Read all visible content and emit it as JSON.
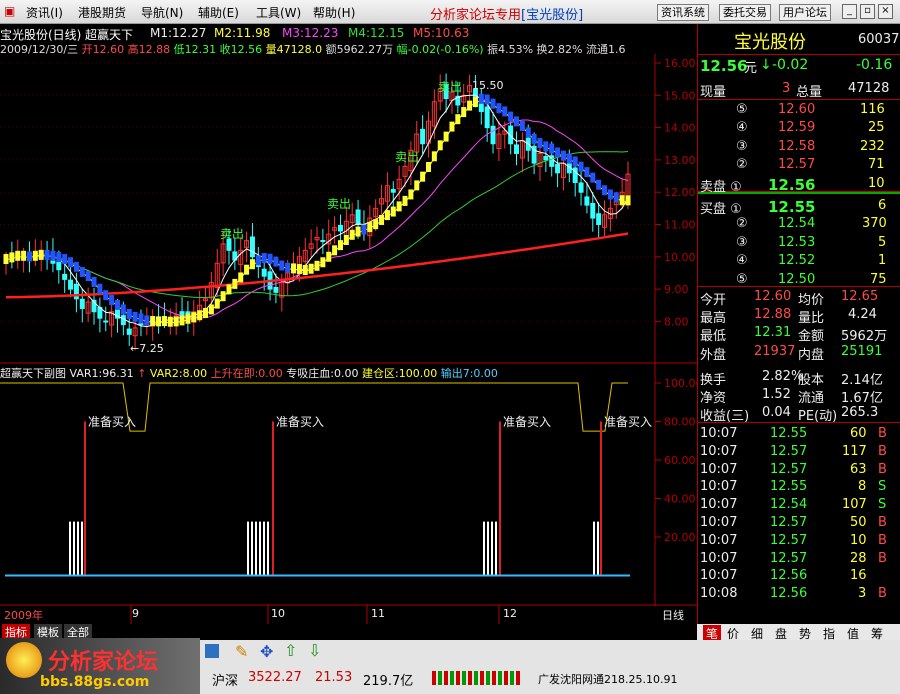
{
  "menu": {
    "items": [
      "资讯(I)",
      "港股期货",
      "导航(N)",
      "辅助(E)",
      "工具(W)",
      "帮助(H)"
    ],
    "title": "分析家论坛专用",
    "title_stock": "[宝光股份]",
    "buttons": [
      "资讯系统",
      "委托交易",
      "用户论坛"
    ]
  },
  "chart_header": {
    "stock": "宝光股份(日线)",
    "indicator": "超赢天下",
    "m1": "M1:12.27",
    "m2": "M2:11.98",
    "m3": "M3:12.23",
    "m4": "M4:12.15",
    "m5": "M5:10.63"
  },
  "info": {
    "date": "2009/12/30/三",
    "open": "开12.60",
    "high": "高12.88",
    "low": "低12.31",
    "close": "收12.56",
    "vol": "量47128.0",
    "amt": "额5962.27万",
    "fluct": "幅-0.02(-0.16%)",
    "amp": "振4.53%",
    "turn": "换2.82%",
    "float": "流通1.6"
  },
  "price_axis": [
    "16.00",
    "15.00",
    "14.00",
    "13.00",
    "12.00",
    "11.00",
    "10.00",
    "9.00",
    "8.00"
  ],
  "chart_labels": {
    "sell": "卖出",
    "buy": "买入",
    "high": "15.50",
    "low": "←7.25"
  },
  "sub_header": {
    "name": "超赢天下副图",
    "var1": "VAR1:96.31",
    "var2": "VAR2:8.00",
    "up": "上升在即:0.00",
    "zh": "专吸庄血:0.00",
    "jc": "建仓区:100.00",
    "out": "输出7:0.00"
  },
  "sub_axis": [
    "100.00",
    "80.00",
    "60.00",
    "40.00",
    "20.00"
  ],
  "sub_labels": [
    "准备买入",
    "准备买入",
    "准备买入",
    "准备买入"
  ],
  "time_axis": [
    "2009年",
    "9",
    "10",
    "11",
    "12",
    "日线"
  ],
  "bottom_tabs": [
    "指标",
    "模板",
    "全部"
  ],
  "quote": {
    "name": "宝光股份",
    "code": "600379",
    "price": "12.56",
    "unit": "元",
    "chg": "-0.02",
    "chg2": "-0.16",
    "now_label": "现量",
    "now": "3",
    "total_label": "总量",
    "total": "47128",
    "sell": [
      {
        "l": "⑤",
        "p": "12.60",
        "v": "116"
      },
      {
        "l": "④",
        "p": "12.59",
        "v": "25"
      },
      {
        "l": "③",
        "p": "12.58",
        "v": "232"
      },
      {
        "l": "②",
        "p": "12.57",
        "v": "71"
      },
      {
        "l": "卖盘 ①",
        "p": "12.56",
        "v": "10"
      }
    ],
    "buy": [
      {
        "l": "买盘 ①",
        "p": "12.55",
        "v": "6"
      },
      {
        "l": "②",
        "p": "12.54",
        "v": "370"
      },
      {
        "l": "③",
        "p": "12.53",
        "v": "5"
      },
      {
        "l": "④",
        "p": "12.52",
        "v": "1"
      },
      {
        "l": "⑤",
        "p": "12.50",
        "v": "75"
      }
    ],
    "stats": [
      [
        "今开",
        "12.60",
        "均价",
        "12.65"
      ],
      [
        "最高",
        "12.88",
        "量比",
        "4.24"
      ],
      [
        "最低",
        "12.31",
        "金额",
        "5962万"
      ],
      [
        "外盘",
        "21937",
        "内盘",
        "25191"
      ],
      [
        "换手",
        "2.82%",
        "股本",
        "2.14亿"
      ],
      [
        "净资",
        "1.52",
        "流通",
        "1.67亿"
      ],
      [
        "收益(三)",
        "0.04",
        "PE(动)",
        "265.3"
      ]
    ],
    "ticks": [
      [
        "10:07",
        "12.55",
        "60",
        "B"
      ],
      [
        "10:07",
        "12.57",
        "117",
        "B"
      ],
      [
        "10:07",
        "12.57",
        "63",
        "B"
      ],
      [
        "10:07",
        "12.55",
        "8",
        "S"
      ],
      [
        "10:07",
        "12.54",
        "107",
        "S"
      ],
      [
        "10:07",
        "12.57",
        "50",
        "B"
      ],
      [
        "10:07",
        "12.57",
        "10",
        "B"
      ],
      [
        "10:07",
        "12.57",
        "28",
        "B"
      ],
      [
        "10:07",
        "12.56",
        "16",
        ""
      ],
      [
        "10:08",
        "12.56",
        "3",
        "B"
      ]
    ]
  },
  "right_tabs": [
    "笔",
    "价",
    "细",
    "盘",
    "势",
    "指",
    "值",
    "筹"
  ],
  "status": {
    "market": "沪深",
    "index": "3522.27",
    "chg": "21.53",
    "amount": "219.7亿",
    "broker": "广发沈阳网通",
    "ip": "218.25.10.91"
  },
  "logo": {
    "text": "分析家论坛",
    "url": "bbs.88gs.com"
  },
  "colors": {
    "red": "#ff4a4a",
    "green": "#39ff39",
    "frame": "#b00000",
    "yellow": "#ffff33"
  }
}
